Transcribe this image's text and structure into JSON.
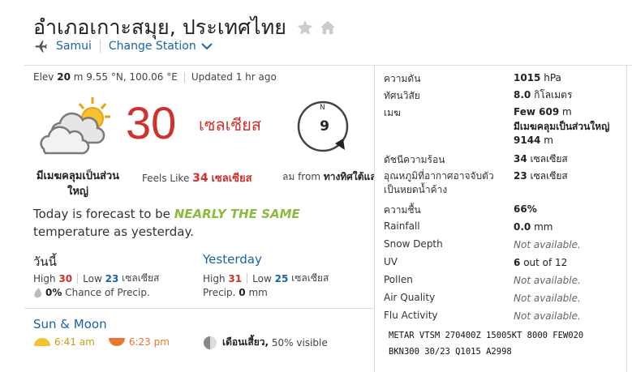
{
  "header": {
    "title": "อำเภอเกาะสมุย, ประเทศไทย",
    "station": "Samui",
    "change_station": "Change Station"
  },
  "colors": {
    "accent_blue": "#1a63a8",
    "temp_red": "#d0312d",
    "forecast_green": "#8cba3c"
  },
  "location": {
    "elev_label": "Elev",
    "elev_value": "20",
    "elev_unit": "m",
    "lat": "9.55 °N, 100.06 °E",
    "updated": "Updated 1 hr ago"
  },
  "current": {
    "icon": "mostly-cloudy-sun-icon",
    "temp": "30",
    "unit": "เซลเซียส",
    "condition": "มีเมฆคลุมเป็นส่วนใหญ่",
    "feels_label": "Feels Like",
    "feels_value": "34",
    "feels_unit": "เซลเซียส",
    "compass_n": "N",
    "wind_speed": "9",
    "wind_prefix": "ลม from",
    "wind_dir": "ทางทิศใต้และ"
  },
  "forecast": {
    "pre": "Today is forecast to be",
    "highlight": "NEARLY THE SAME",
    "post": "temperature as yesterday."
  },
  "today": {
    "label": "วันนี้",
    "high_label": "High",
    "high": "30",
    "low_label": "Low",
    "low": "23",
    "unit": "เซลเซียส",
    "precip_value": "0%",
    "precip_label": "Chance of Precip."
  },
  "yesterday": {
    "label": "Yesterday",
    "high_label": "High",
    "high": "31",
    "low_label": "Low",
    "low": "25",
    "unit": "เซลเซียส",
    "precip_label": "Precip.",
    "precip_value": "0",
    "precip_unit": "mm"
  },
  "sun_moon": {
    "label": "Sun & Moon",
    "sunrise": "6:41 am",
    "sunset": "6:23 pm",
    "moon_phase": "เดือนเสี้ยว,",
    "moon_visible": "50%",
    "moon_visible_label": "visible"
  },
  "details": [
    {
      "label": "ความดัน",
      "value": "1015",
      "unit": "hPa"
    },
    {
      "label": "ทัศนวิสัย",
      "value": "8.0",
      "unit": "กิโลเมตร"
    },
    {
      "label": "เมฆ",
      "value": "Few 609",
      "unit": "m",
      "value2": "มีเมฆคลุมเป็นส่วนใหญ่ 9144",
      "unit2": "m"
    },
    {
      "label": "ดัชนีความร้อน",
      "value": "34",
      "unit": "เซลเซียส"
    },
    {
      "label": "อุณหภูมิที่อากาศอาจจับตัวเป็นหยดน้ำค้าง",
      "value": "23",
      "unit": "เซลเซียส"
    },
    {
      "label": "ความชื้น",
      "value": "66%",
      "unit": ""
    },
    {
      "label": "Rainfall",
      "value": "0.0",
      "unit": "mm"
    },
    {
      "label": "Snow Depth",
      "na": "Not available."
    },
    {
      "label": "UV",
      "value": "6",
      "unit": "out of 12"
    },
    {
      "label": "Pollen",
      "na": "Not available."
    },
    {
      "label": "Air Quality",
      "na": "Not available."
    },
    {
      "label": "Flu Activity",
      "na": "Not available."
    }
  ],
  "metar": {
    "line1": "METAR VTSM 270400Z 15005KT 8000 FEW020",
    "line2": "BKN300 30/23 Q1015 A2998"
  }
}
